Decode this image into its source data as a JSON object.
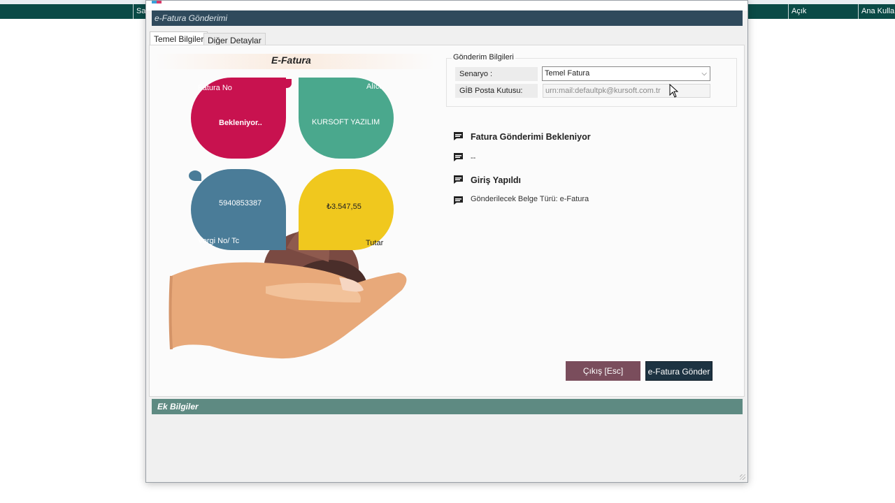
{
  "background": {
    "cells": [
      "Sat",
      "Açık",
      "Ana Kulla"
    ]
  },
  "dialog": {
    "title": "e-Fatura Gönderimi",
    "tabs": [
      {
        "label": "Temel Bilgiler",
        "active": true
      },
      {
        "label": "Diğer Detaylar",
        "active": false
      }
    ],
    "illustration": {
      "title": "E-Fatura",
      "fatura_no_label": "Fatura No",
      "fatura_no_value": "Bekleniyor..",
      "alici_label": "Alıcı",
      "alici_value": "KURSOFT YAZILIM",
      "vergi_value": "5940853387",
      "vergi_label": "Vergi No/ Tc",
      "tutar_value": "₺3.547,55",
      "tutar_label": "Tutar"
    },
    "gonderim": {
      "group_title": "Gönderim Bilgileri",
      "senaryo_label": "Senaryo :",
      "senaryo_value": "Temel Fatura",
      "posta_label": "GİB Posta Kutusu:",
      "posta_value": "urn:mail:defaultpk@kursoft.com.tr"
    },
    "messages": [
      {
        "text": "Fatura Gönderimi Bekleniyor",
        "bold": true
      },
      {
        "text": "--",
        "bold": false
      },
      {
        "text": "Giriş Yapıldı",
        "bold": true
      },
      {
        "text": "Gönderilecek Belge Türü: e-Fatura",
        "bold": false
      }
    ],
    "buttons": {
      "exit_label": "Çıkış [Esc]",
      "send_label": "e-Fatura Gönder"
    },
    "ek_bilgiler_title": "Ek Bilgiler"
  },
  "colors": {
    "header_dark": "#2f4a5c",
    "section_green": "#5e8a82",
    "leaf_red": "#c8124f",
    "leaf_teal": "#4aa88d",
    "leaf_blue": "#4a7c98",
    "leaf_yellow": "#f0c81e"
  }
}
